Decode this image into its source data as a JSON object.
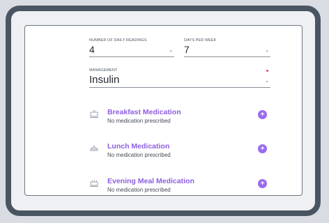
{
  "fields": {
    "daily_readings": {
      "label": "NUMBER OF DAILY READINGS",
      "value": "4"
    },
    "days_per_week": {
      "label": "DAYS PER WEEK",
      "value": "7"
    },
    "management": {
      "label": "MANAGEMENT",
      "value": "Insulin"
    }
  },
  "medications": [
    {
      "title": "Breakfast Medication",
      "subtitle": "No medication prescribed",
      "icon": "breakfast-icon"
    },
    {
      "title": "Lunch Medication",
      "subtitle": "No medication prescribed",
      "icon": "lunch-icon"
    },
    {
      "title": "Evening Meal Medication",
      "subtitle": "No medication prescribed",
      "icon": "evening-meal-icon"
    }
  ],
  "colors": {
    "accent": "#9b6bf0",
    "title": "#8e5ee0",
    "required": "#e0475a",
    "frame": "#4a5563"
  }
}
